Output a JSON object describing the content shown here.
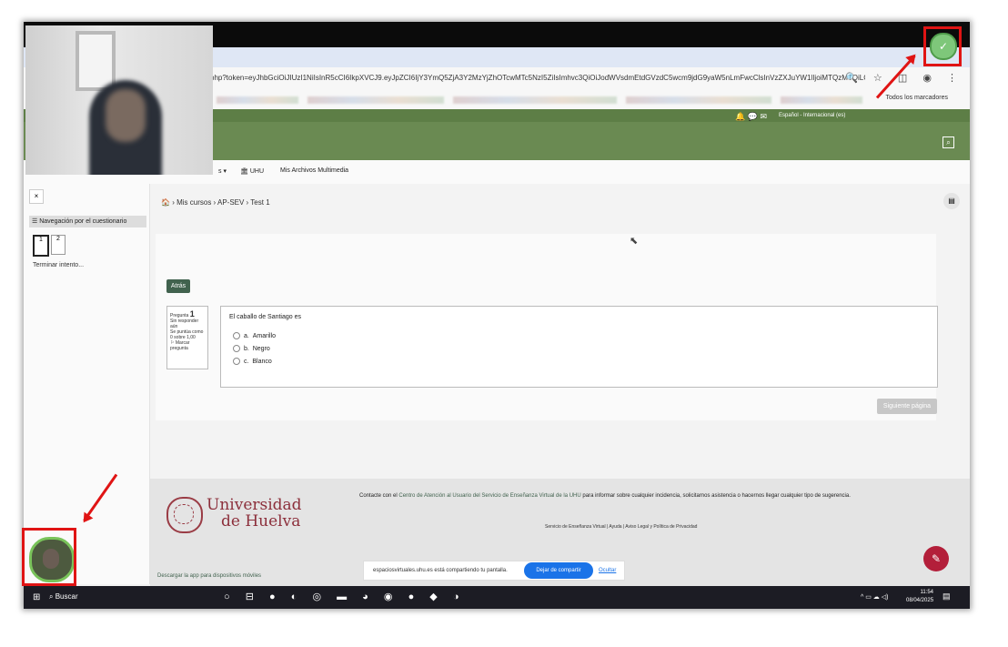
{
  "browser": {
    "url": "php?token=eyJhbGciOiJIUzI1NiIsInR5cCI6IkpXVCJ9.eyJpZCI6IjY3YmQ5ZjA3Y2MzYjZhOTcwMTc5NzI5ZiIsImhvc3QiOiJodWVsdmEtdGVzdC5wcm9jdG9yaW5nLmFwcClsInVzZXJuYW1lIjoiMTQzMTQiLCJuaWNrbmFtZSI...",
    "bookmarks_label": "Todos los marcadores"
  },
  "header": {
    "language": "Español - Internacional (es)"
  },
  "nav": {
    "item_uhu": "UHU",
    "item_media": "Mis Archivos Multimedia"
  },
  "sidebar": {
    "close": "×",
    "title": "Navegación por el cuestionario",
    "q1": "1",
    "q2": "2",
    "finish": "Terminar intento..."
  },
  "breadcrumb": "› Mis cursos › AP-SEV › Test 1",
  "quiz": {
    "back": "Atrás",
    "question_label": "Pregunta",
    "question_number": "1",
    "status": "Sin responder aún",
    "score": "Se puntúa como 0 sobre 1,00",
    "flag": "Marcar pregunta",
    "question_text": "El caballo de Santiago es",
    "options": [
      {
        "letter": "a.",
        "text": "Amarillo"
      },
      {
        "letter": "b.",
        "text": "Negro"
      },
      {
        "letter": "c.",
        "text": "Blanco"
      }
    ],
    "next": "Siguiente página"
  },
  "footer": {
    "university_line1": "Universidad",
    "university_line2": "de Huelva",
    "contact_pre": "Contacte con el",
    "contact_link": "Centro de Atención al Usuario del Servicio de Enseñanza Virtual de la UHU",
    "contact_post": "para informar sobre cualquier incidencia, solicitarnos asistencia o hacernos llegar cualquier tipo de sugerencia.",
    "links": "Servicio de Enseñanza Virtual | Ayuda | Aviso Legal y Política de Privacidad",
    "app": "Descargar la app para dispositivos móviles"
  },
  "share_bar": {
    "message": "espaciosvirtuales.uhu.es está compartiendo tu pantalla.",
    "stop": "Dejar de compartir",
    "hide": "Ocultar"
  },
  "taskbar": {
    "search": "Buscar",
    "time": "11:54",
    "date": "08/04/2025"
  },
  "colors": {
    "accent_green": "#41624e",
    "header_green": "#6a8a52",
    "annotation_red": "#e01414"
  }
}
